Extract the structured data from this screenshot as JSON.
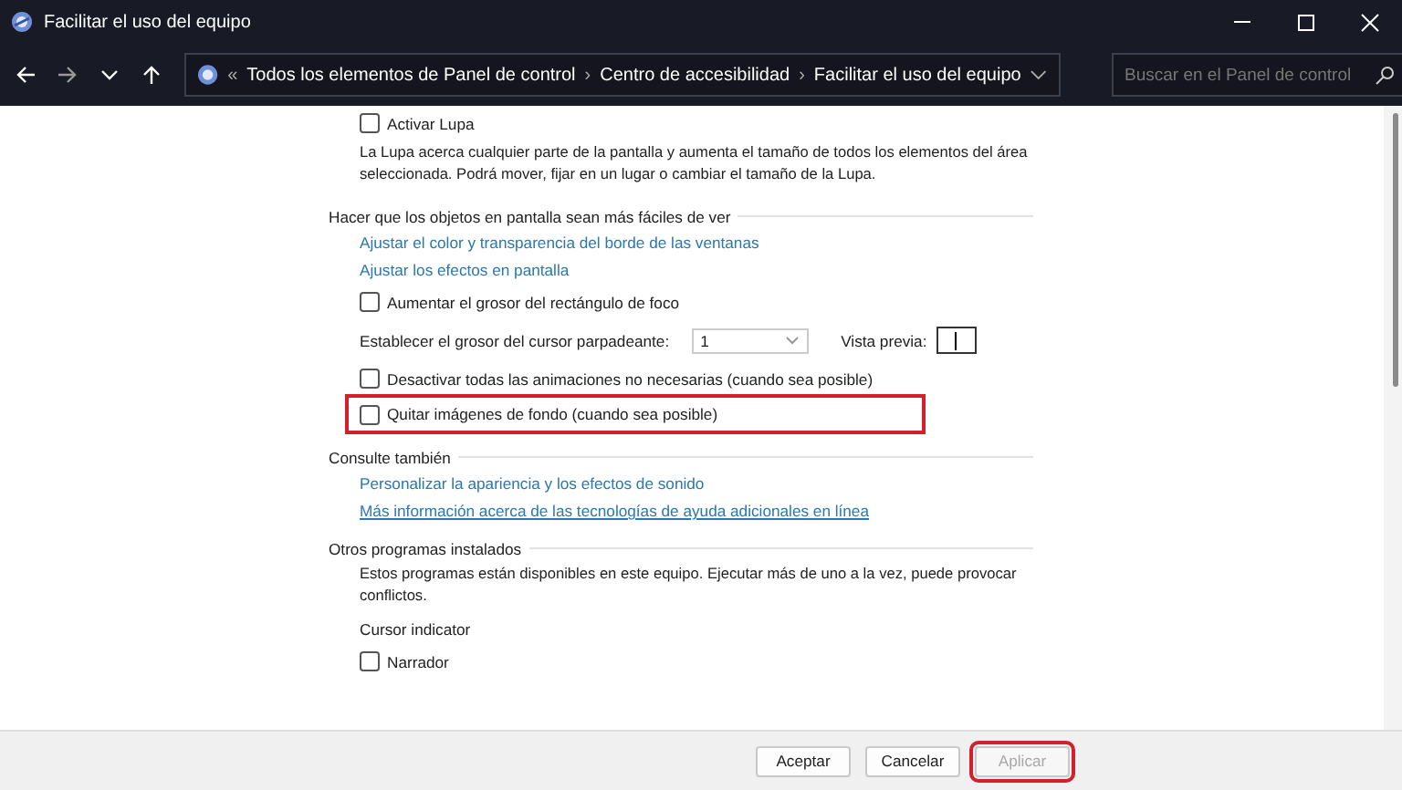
{
  "window": {
    "title": "Facilitar el uso del equipo"
  },
  "address_bar": {
    "overflow": "«",
    "crumbs": [
      "Todos los elementos de Panel de control",
      "Centro de accesibilidad",
      "Facilitar el uso del equipo"
    ],
    "separator": "›"
  },
  "search": {
    "placeholder": "Buscar en el Panel de control"
  },
  "sections": [
    {
      "items": [
        {
          "kind": "checkbox",
          "label": "Activar Lupa",
          "checked": false,
          "highlighted": false
        },
        {
          "kind": "description",
          "text": "La Lupa acerca cualquier parte de la pantalla y aumenta el tamaño de todos los elementos del área seleccionada. Podrá mover, fijar en un lugar o cambiar el tamaño de la Lupa."
        }
      ]
    },
    {
      "heading": "Hacer que los objetos en pantalla sean más fáciles de ver",
      "items": [
        {
          "kind": "link",
          "label": "Ajustar el color y transparencia del borde de las ventanas",
          "underlined": false
        },
        {
          "kind": "link",
          "label": "Ajustar los efectos en pantalla",
          "underlined": false
        },
        {
          "kind": "checkbox",
          "label": "Aumentar el grosor del rectángulo de foco",
          "checked": false,
          "highlighted": false
        },
        {
          "kind": "cursor",
          "label": "Establecer el grosor del cursor parpadeante:",
          "value": "1",
          "preview_label": "Vista previa:"
        },
        {
          "kind": "checkbox",
          "label": "Desactivar todas las animaciones no necesarias (cuando sea posible)",
          "checked": false,
          "highlighted": false
        },
        {
          "kind": "checkbox",
          "label": "Quitar imágenes de fondo (cuando sea posible)",
          "checked": false,
          "highlighted": true
        }
      ]
    },
    {
      "heading": "Consulte también",
      "items": [
        {
          "kind": "link",
          "label": "Personalizar la apariencia y los efectos de sonido",
          "underlined": false
        },
        {
          "kind": "link",
          "label": "Más información acerca de las tecnologías de ayuda adicionales en línea",
          "underlined": true
        }
      ]
    },
    {
      "heading": "Otros programas instalados",
      "items": [
        {
          "kind": "description",
          "text": "Estos programas están disponibles en este equipo. Ejecutar más de uno a la vez, puede provocar conflictos."
        },
        {
          "kind": "label",
          "text": "Cursor indicator"
        },
        {
          "kind": "checkbox",
          "label": "Narrador",
          "checked": false,
          "highlighted": false
        }
      ]
    }
  ],
  "buttons": [
    {
      "label": "Aceptar",
      "disabled": false,
      "highlighted": false
    },
    {
      "label": "Cancelar",
      "disabled": false,
      "highlighted": false
    },
    {
      "label": "Aplicar",
      "disabled": true,
      "highlighted": true
    }
  ]
}
